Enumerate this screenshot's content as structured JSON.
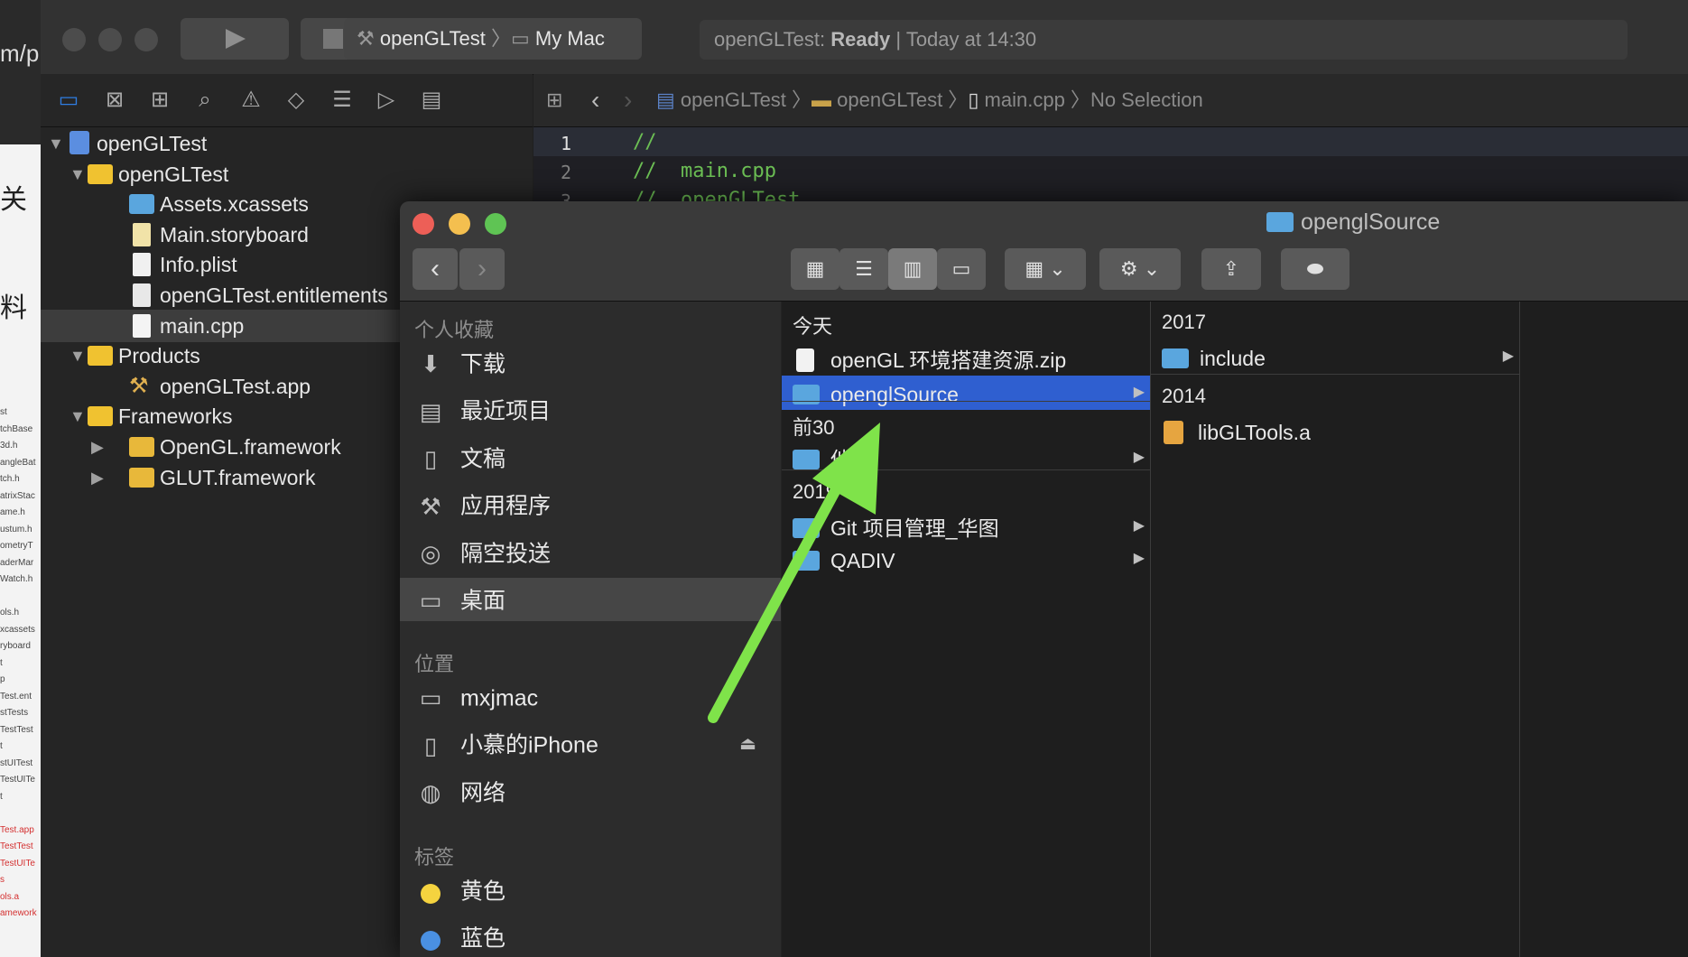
{
  "background_app": {
    "url_fragment": "m/p",
    "chars": [
      "关",
      "料"
    ],
    "sidebar_snippets": [
      "st",
      "tchBase",
      "3d.h",
      "angleBat",
      "tch.h",
      "atrixStac",
      "ame.h",
      "ustum.h",
      "ometryT",
      "aderMar",
      "Watch.h",
      "",
      "ols.h",
      "xcassets",
      "ryboard",
      "t",
      "p",
      "Test.ent",
      "stTests",
      "TestTest",
      "t",
      "stUITest",
      "TestUITe",
      "t",
      "",
      "Test.app",
      "TestTest",
      "TestUITe",
      "s",
      "ols.a",
      "amework"
    ]
  },
  "xcode": {
    "scheme": {
      "project": "openGLTest",
      "device": "My Mac"
    },
    "activity": {
      "prefix": "openGLTest: ",
      "status": "Ready",
      "time": " | Today at 14:30"
    },
    "navigator_icons": [
      "folder-icon",
      "source-control-icon",
      "hierarchy-icon",
      "search-icon",
      "warning-icon",
      "test-icon",
      "debug-icon",
      "breakpoint-icon",
      "report-icon"
    ],
    "tree": [
      {
        "label": "openGLTest",
        "level": 0,
        "kind": "project",
        "expanded": true
      },
      {
        "label": "openGLTest",
        "level": 1,
        "kind": "folder",
        "expanded": true
      },
      {
        "label": "Assets.xcassets",
        "level": 2,
        "kind": "assets"
      },
      {
        "label": "Main.storyboard",
        "level": 2,
        "kind": "storyboard"
      },
      {
        "label": "Info.plist",
        "level": 2,
        "kind": "plist"
      },
      {
        "label": "openGLTest.entitlements",
        "level": 2,
        "kind": "entitlements"
      },
      {
        "label": "main.cpp",
        "level": 2,
        "kind": "cpp",
        "selected": true
      },
      {
        "label": "Products",
        "level": 1,
        "kind": "folder",
        "expanded": true
      },
      {
        "label": "openGLTest.app",
        "level": 2,
        "kind": "app"
      },
      {
        "label": "Frameworks",
        "level": 1,
        "kind": "folder",
        "expanded": true
      },
      {
        "label": "OpenGL.framework",
        "level": 2,
        "kind": "framework",
        "collapsed": true
      },
      {
        "label": "GLUT.framework",
        "level": 2,
        "kind": "framework",
        "collapsed": true
      }
    ],
    "breadcrumb": [
      "openGLTest",
      "openGLTest",
      "main.cpp",
      "No Selection"
    ],
    "code_lines": [
      {
        "n": "1",
        "text": "//"
      },
      {
        "n": "2",
        "text": "//  main.cpp"
      },
      {
        "n": "3",
        "text": "//  openGLTest"
      }
    ]
  },
  "finder": {
    "title": "openglSource",
    "sidebar": {
      "favorites_header": "个人收藏",
      "favorites": [
        {
          "icon": "download-icon",
          "label": "下载"
        },
        {
          "icon": "recents-icon",
          "label": "最近项目"
        },
        {
          "icon": "documents-icon",
          "label": "文稿"
        },
        {
          "icon": "applications-icon",
          "label": "应用程序"
        },
        {
          "icon": "airdrop-icon",
          "label": "隔空投送"
        },
        {
          "icon": "desktop-icon",
          "label": "桌面",
          "selected": true
        }
      ],
      "locations_header": "位置",
      "locations": [
        {
          "icon": "laptop-icon",
          "label": "mxjmac"
        },
        {
          "icon": "iphone-icon",
          "label": "小慕的iPhone",
          "eject": "⏏"
        },
        {
          "icon": "network-icon",
          "label": "网络"
        }
      ],
      "tags_header": "标签",
      "tags": [
        {
          "label": "黄色",
          "color": "#f5d33f"
        },
        {
          "label": "蓝色",
          "color": "#4a90e2"
        }
      ]
    },
    "column1": {
      "groups": [
        {
          "header": "今天",
          "items": [
            {
              "label": "openGL 环境搭建资源.zip",
              "kind": "zip"
            },
            {
              "label": "openglSource",
              "kind": "folder",
              "selected": true,
              "has_children": true
            }
          ]
        },
        {
          "header": "前30",
          "items": [
            {
              "label": "他",
              "kind": "folder",
              "has_children": true
            }
          ]
        },
        {
          "header": "2019",
          "items": [
            {
              "label": "Git 项目管理_华图",
              "kind": "folder",
              "has_children": true
            },
            {
              "label": "QADIV",
              "kind": "folder",
              "has_children": true
            }
          ]
        }
      ]
    },
    "column2": {
      "groups": [
        {
          "header": "2017",
          "items": [
            {
              "label": "include",
              "kind": "folder",
              "has_children": true
            }
          ]
        },
        {
          "header": "2014",
          "items": [
            {
              "label": "libGLTools.a",
              "kind": "archive"
            }
          ]
        }
      ]
    },
    "accent_color": "#2f5fd0",
    "annotation_arrow_color": "#7fe34a"
  }
}
